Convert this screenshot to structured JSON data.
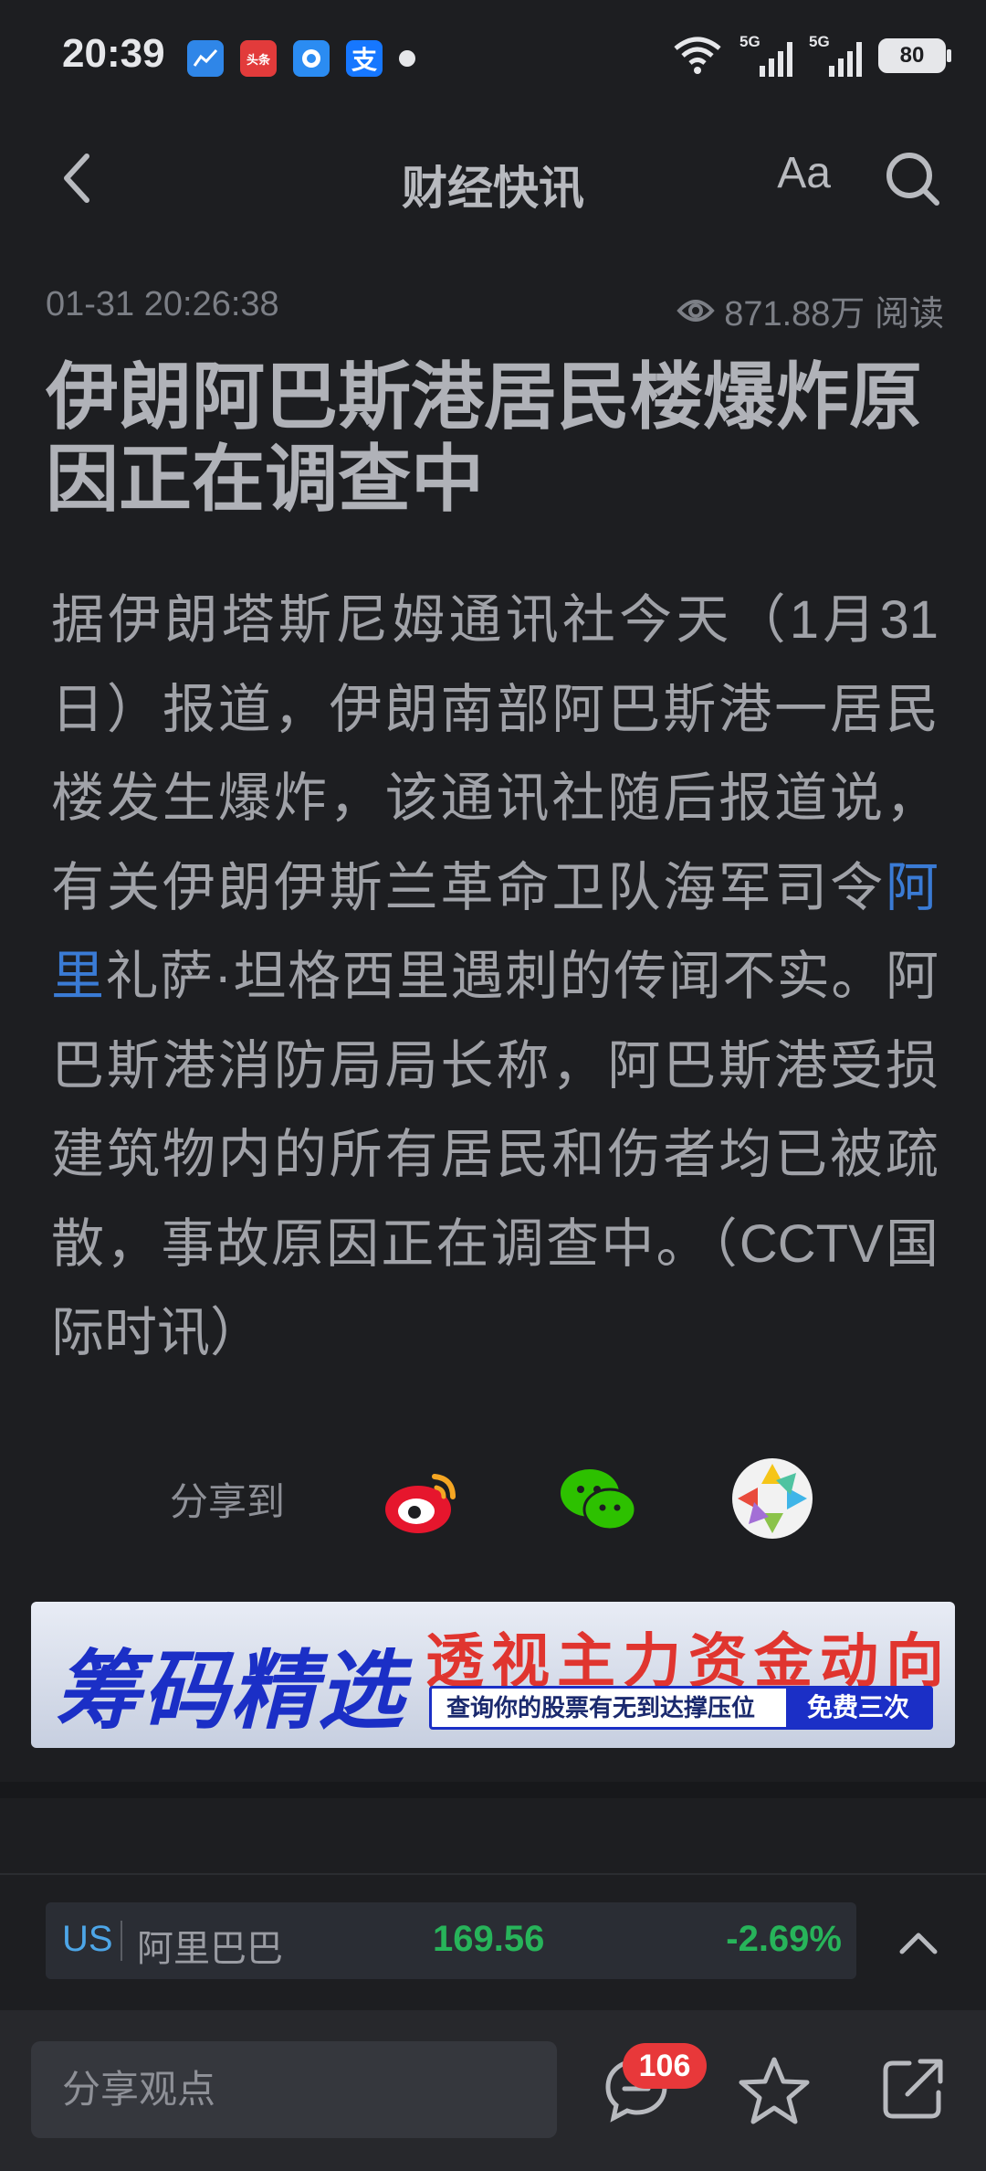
{
  "status_bar": {
    "time": "20:39",
    "notifications": [
      "chart-app-icon",
      "toutiao-app-icon",
      "browser-app-icon",
      "alipay-app-icon"
    ],
    "toutiao_label": "头条",
    "alipay_label": "支",
    "signal_1_label": "5G",
    "signal_2_label": "5G",
    "battery": "80"
  },
  "nav": {
    "title": "财经快讯",
    "font_label": "Aa"
  },
  "article": {
    "timestamp": "01-31 20:26:38",
    "views": "871.88万 阅读",
    "title": "伊朗阿巴斯港居民楼爆炸原因正在调查中",
    "body_part1": "据伊朗塔斯尼姆通讯社今天（1月31日）报道，伊朗南部阿巴斯港一居民楼发生爆炸，该通讯社随后报道说，有关伊朗伊斯兰革命卫队海军司令",
    "body_link": "阿里",
    "body_part2": "礼萨·坦格西里遇刺的传闻不实。阿巴斯港消防局局长称，阿巴斯港受损建筑物内的所有居民和伤者均已被疏散，事故原因正在调查中。（CCTV国际时讯）"
  },
  "share": {
    "label": "分享到",
    "targets": [
      "weibo-icon",
      "wechat-icon",
      "moments-icon"
    ]
  },
  "ad": {
    "left_text": "筹码精选",
    "headline": "透视主力资金动向",
    "subline": "查询你的股票有无到达撑压位",
    "cta": "免费三次"
  },
  "stock": {
    "market": "US",
    "name": "阿里巴巴",
    "price": "169.56",
    "change": "-2.69%"
  },
  "bottom": {
    "comment_placeholder": "分享观点",
    "message_count": "106"
  },
  "colors": {
    "background": "#1d1e21",
    "accent_link": "#3a7bd5",
    "stock_green": "#27b45a",
    "badge_red": "#e8383a"
  }
}
